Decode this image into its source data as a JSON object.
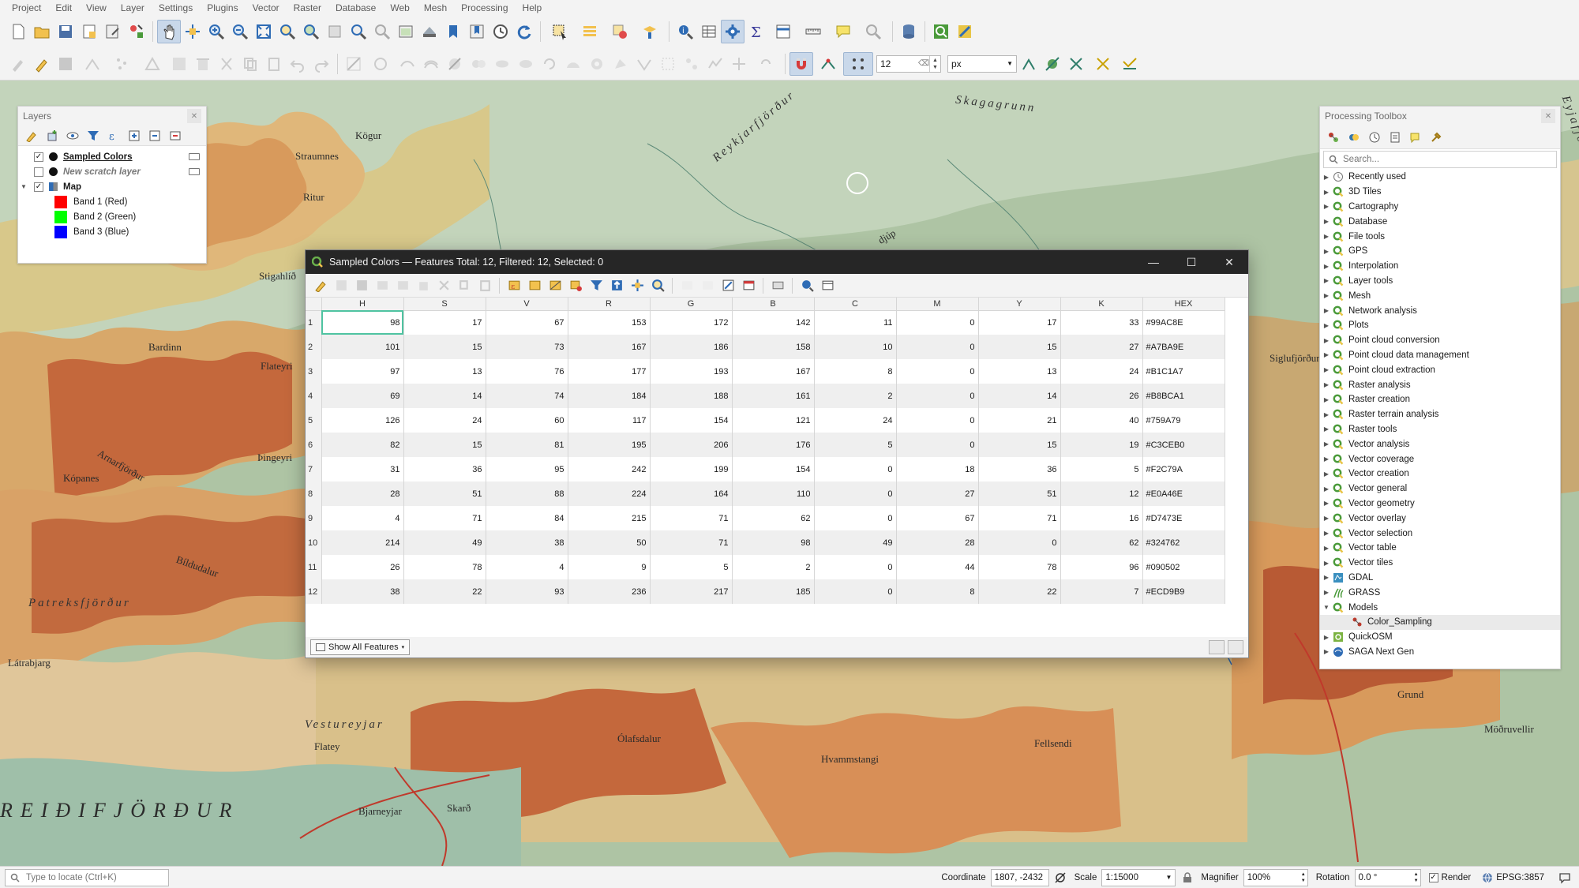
{
  "menu": [
    "Project",
    "Edit",
    "View",
    "Layer",
    "Settings",
    "Plugins",
    "Vector",
    "Raster",
    "Database",
    "Web",
    "Mesh",
    "Processing",
    "Help"
  ],
  "toolbar2": {
    "snap_tolerance": "12",
    "unit": "px"
  },
  "map": {
    "labels": {
      "skagagrunn": "Skagagrunn",
      "reykjarfjordur": "Reykjarfjörður",
      "kogur": "Kögur",
      "straumnes": "Straumnes",
      "ritur": "Ritur",
      "stigahlid": "Stigahlíð",
      "bardinn": "Bardinn",
      "flateyri": "Flateyri",
      "thingeyri": "Þingeyri",
      "kopanes": "Kópanes",
      "arnarfjordur": "Arnarfjörður",
      "bildudalur": "Bíldudalur",
      "patreksfjordur": "Patreksfjörður",
      "latrabjarg": "Látrabjarg",
      "flatey": "Flatey",
      "vestureyjar": "Vestureyjar",
      "breidifjordur": "REIÐIFJÖRÐUR",
      "bjarneyjar": "Bjarneyjar",
      "skard": "Skarð",
      "olafsdalur": "Ólafsdalur",
      "hvammstangi": "Hvammstangi",
      "fellsendi": "Fellsendi",
      "modruvellir": "Möðruvellir",
      "grund": "Grund",
      "siglufjordur": "Siglufjörður",
      "eyjafjordur": "Eyjafjörður",
      "djup": "djúp"
    }
  },
  "layers_panel": {
    "title": "Layers",
    "items": [
      {
        "name": "Sampled Colors",
        "checked": true,
        "kind": "point"
      },
      {
        "name": "New scratch layer",
        "checked": false,
        "kind": "point"
      },
      {
        "name": "Map",
        "checked": true,
        "kind": "raster"
      }
    ],
    "bands": [
      {
        "label": "Band 1 (Red)",
        "color": "#ff0000"
      },
      {
        "label": "Band 2 (Green)",
        "color": "#00ff00"
      },
      {
        "label": "Band 3 (Blue)",
        "color": "#0000ff"
      }
    ]
  },
  "attribute_table": {
    "title": "Sampled Colors — Features Total: 12, Filtered: 12, Selected: 0",
    "columns": [
      "H",
      "S",
      "V",
      "R",
      "G",
      "B",
      "C",
      "M",
      "Y",
      "K",
      "HEX"
    ],
    "rows": [
      [
        "98",
        "17",
        "67",
        "153",
        "172",
        "142",
        "11",
        "0",
        "17",
        "33",
        "#99AC8E"
      ],
      [
        "101",
        "15",
        "73",
        "167",
        "186",
        "158",
        "10",
        "0",
        "15",
        "27",
        "#A7BA9E"
      ],
      [
        "97",
        "13",
        "76",
        "177",
        "193",
        "167",
        "8",
        "0",
        "13",
        "24",
        "#B1C1A7"
      ],
      [
        "69",
        "14",
        "74",
        "184",
        "188",
        "161",
        "2",
        "0",
        "14",
        "26",
        "#B8BCA1"
      ],
      [
        "126",
        "24",
        "60",
        "117",
        "154",
        "121",
        "24",
        "0",
        "21",
        "40",
        "#759A79"
      ],
      [
        "82",
        "15",
        "81",
        "195",
        "206",
        "176",
        "5",
        "0",
        "15",
        "19",
        "#C3CEB0"
      ],
      [
        "31",
        "36",
        "95",
        "242",
        "199",
        "154",
        "0",
        "18",
        "36",
        "5",
        "#F2C79A"
      ],
      [
        "28",
        "51",
        "88",
        "224",
        "164",
        "110",
        "0",
        "27",
        "51",
        "12",
        "#E0A46E"
      ],
      [
        "4",
        "71",
        "84",
        "215",
        "71",
        "62",
        "0",
        "67",
        "71",
        "16",
        "#D7473E"
      ],
      [
        "214",
        "49",
        "38",
        "50",
        "71",
        "98",
        "49",
        "28",
        "0",
        "62",
        "#324762"
      ],
      [
        "26",
        "78",
        "4",
        "9",
        "5",
        "2",
        "0",
        "44",
        "78",
        "96",
        "#090502"
      ],
      [
        "38",
        "22",
        "93",
        "236",
        "217",
        "185",
        "0",
        "8",
        "22",
        "7",
        "#ECD9B9"
      ]
    ],
    "show_all_label": "Show All Features"
  },
  "toolbox": {
    "title": "Processing Toolbox",
    "search_placeholder": "Search...",
    "items": [
      {
        "label": "Recently used",
        "icon": "clock-icon"
      },
      {
        "label": "3D Tiles",
        "icon": "qgis-icon"
      },
      {
        "label": "Cartography",
        "icon": "qgis-icon"
      },
      {
        "label": "Database",
        "icon": "qgis-icon"
      },
      {
        "label": "File tools",
        "icon": "qgis-icon"
      },
      {
        "label": "GPS",
        "icon": "qgis-icon"
      },
      {
        "label": "Interpolation",
        "icon": "qgis-icon"
      },
      {
        "label": "Layer tools",
        "icon": "qgis-icon"
      },
      {
        "label": "Mesh",
        "icon": "qgis-icon"
      },
      {
        "label": "Network analysis",
        "icon": "qgis-icon"
      },
      {
        "label": "Plots",
        "icon": "qgis-icon"
      },
      {
        "label": "Point cloud conversion",
        "icon": "qgis-icon"
      },
      {
        "label": "Point cloud data management",
        "icon": "qgis-icon"
      },
      {
        "label": "Point cloud extraction",
        "icon": "qgis-icon"
      },
      {
        "label": "Raster analysis",
        "icon": "qgis-icon"
      },
      {
        "label": "Raster creation",
        "icon": "qgis-icon"
      },
      {
        "label": "Raster terrain analysis",
        "icon": "qgis-icon"
      },
      {
        "label": "Raster tools",
        "icon": "qgis-icon"
      },
      {
        "label": "Vector analysis",
        "icon": "qgis-icon"
      },
      {
        "label": "Vector coverage",
        "icon": "qgis-icon"
      },
      {
        "label": "Vector creation",
        "icon": "qgis-icon"
      },
      {
        "label": "Vector general",
        "icon": "qgis-icon"
      },
      {
        "label": "Vector geometry",
        "icon": "qgis-icon"
      },
      {
        "label": "Vector overlay",
        "icon": "qgis-icon"
      },
      {
        "label": "Vector selection",
        "icon": "qgis-icon"
      },
      {
        "label": "Vector table",
        "icon": "qgis-icon"
      },
      {
        "label": "Vector tiles",
        "icon": "qgis-icon"
      },
      {
        "label": "GDAL",
        "icon": "gdal-icon"
      },
      {
        "label": "GRASS",
        "icon": "grass-icon"
      },
      {
        "label": "Models",
        "icon": "qgis-icon",
        "expanded": true
      },
      {
        "label": "Color_Sampling",
        "icon": "model-icon",
        "child": true
      },
      {
        "label": "QuickOSM",
        "icon": "quickosm-icon"
      },
      {
        "label": "SAGA Next Gen",
        "icon": "saga-icon"
      }
    ]
  },
  "statusbar": {
    "locate_placeholder": "Type to locate (Ctrl+K)",
    "coordinate_label": "Coordinate",
    "coordinate_value": "1807, -2432",
    "scale_label": "Scale",
    "scale_value": "1:15000",
    "magnifier_label": "Magnifier",
    "magnifier_value": "100%",
    "rotation_label": "Rotation",
    "rotation_value": "0.0 °",
    "render_label": "Render",
    "crs": "EPSG:3857"
  },
  "colors": {
    "accent": "#4fc3a1",
    "qgis_green": "#4a9a3a",
    "titlebar": "#262626"
  }
}
